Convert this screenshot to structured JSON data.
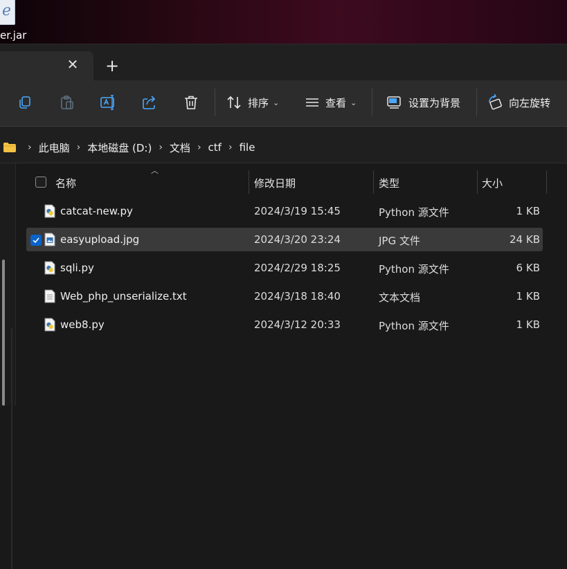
{
  "desktop": {
    "file_label": "er.jar",
    "icon": "jar-file-icon"
  },
  "tabbar": {
    "close_glyph": "✕",
    "new_tab_glyph": "+"
  },
  "toolbar": {
    "copy_icon": "copy-icon",
    "paste_icon": "paste-icon",
    "rename_icon": "rename-icon",
    "share_icon": "share-icon",
    "delete_icon": "delete-icon",
    "sort_label": "排序",
    "view_label": "查看",
    "set_background_label": "设置为背景",
    "rotate_left_label": "向左旋转"
  },
  "breadcrumb": {
    "items": [
      "此电脑",
      "本地磁盘 (D:)",
      "文档",
      "ctf",
      "file"
    ],
    "separator": "›"
  },
  "columns": {
    "name": "名称",
    "modified": "修改日期",
    "type": "类型",
    "size": "大小"
  },
  "files": [
    {
      "name": "catcat-new.py",
      "modified": "2024/3/19 15:45",
      "type": "Python 源文件",
      "size": "1 KB",
      "icon": "python-file-icon",
      "selected": false
    },
    {
      "name": "easyupload.jpg",
      "modified": "2024/3/20 23:24",
      "type": "JPG 文件",
      "size": "24 KB",
      "icon": "image-file-icon",
      "selected": true
    },
    {
      "name": "sqli.py",
      "modified": "2024/2/29 18:25",
      "type": "Python 源文件",
      "size": "6 KB",
      "icon": "python-file-icon",
      "selected": false
    },
    {
      "name": "Web_php_unserialize.txt",
      "modified": "2024/3/18 18:40",
      "type": "文本文档",
      "size": "1 KB",
      "icon": "text-file-icon",
      "selected": false
    },
    {
      "name": "web8.py",
      "modified": "2024/3/12 20:33",
      "type": "Python 源文件",
      "size": "1 KB",
      "icon": "python-file-icon",
      "selected": false
    }
  ],
  "colors": {
    "window_bg": "#191919",
    "toolbar_bg": "#2c2c2c",
    "selection_bg": "#3a3a3a",
    "accent": "#0a63c9",
    "folder": "#f3c242"
  }
}
